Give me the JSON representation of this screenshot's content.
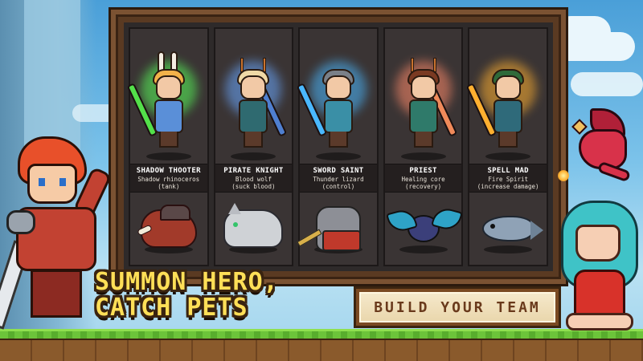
{
  "heroes": [
    {
      "name": "SHADOW THOOTER",
      "pet": "Shadow rhinoceros",
      "role": "(tank)",
      "hair": "#f2b24a",
      "body": "#5a8fd8",
      "weapon": "#53e04a",
      "glow": "#58ff5a",
      "feature": "bunny-ears",
      "pet_type": "boar"
    },
    {
      "name": "PIRATE KNIGHT",
      "pet": "Blood wolf",
      "role": "(suck blood)",
      "hair": "#f0d9a6",
      "body": "#2f6a70",
      "weapon": "#4f7fd0",
      "glow": "#6aa8ff",
      "feature": "antlers",
      "pet_type": "wolf"
    },
    {
      "name": "SWORD SAINT",
      "pet": "Thunder lizard",
      "role": "(control)",
      "hair": "#c9a16a",
      "body": "#3a8fa6",
      "weapon": "#4ab8ff",
      "glow": "#4ab8ff",
      "feature": "cap",
      "pet_type": "cat"
    },
    {
      "name": "PRIEST",
      "pet": "Healing core",
      "role": "(recovery)",
      "hair": "#7a3a22",
      "body": "#2f7a6a",
      "weapon": "#f08a5a",
      "glow": "#ff8a6a",
      "feature": "antlers",
      "pet_type": "bat"
    },
    {
      "name": "SPELL MAD",
      "pet": "Fire Spirit",
      "role": "(increase damage)",
      "hair": "#2f6a3a",
      "body": "#2f6a7a",
      "weapon": "#ffb030",
      "glow": "#ffb030",
      "feature": "hood",
      "pet_type": "fish"
    }
  ],
  "headline": {
    "line1": "SUMMON HERO,",
    "line2": "CATCH PETS"
  },
  "cta_label": "BUILD YOUR TEAM",
  "colors": {
    "headline": "#ffdf57",
    "board_wood": "#7b5232",
    "cta_text": "#6a3a1c"
  }
}
